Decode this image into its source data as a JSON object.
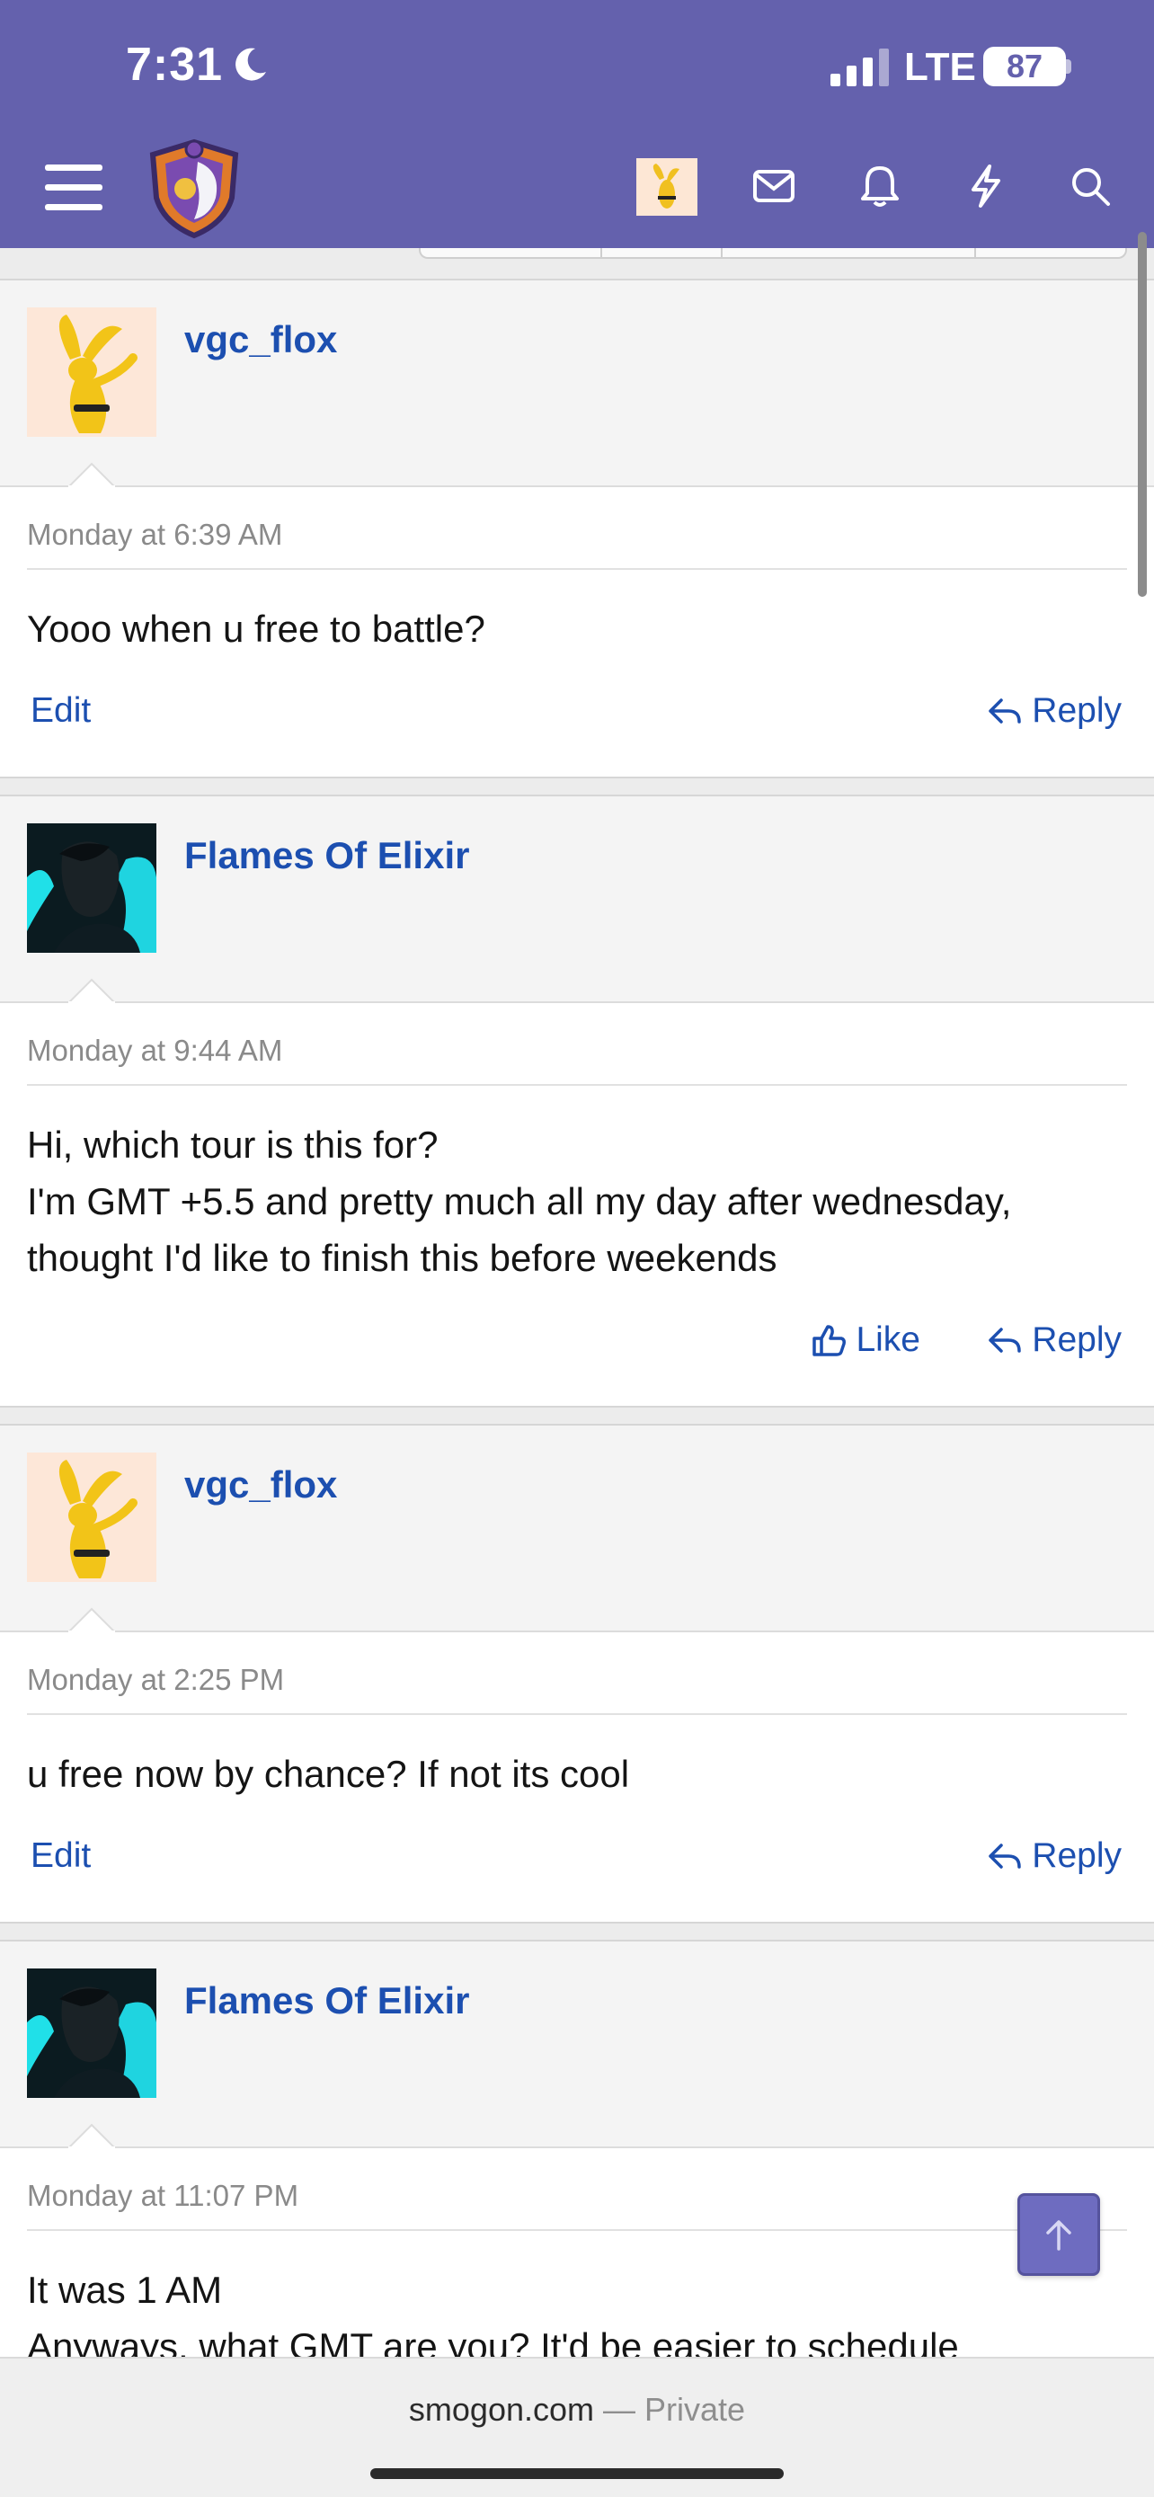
{
  "status_bar": {
    "time": "7:31",
    "network": "LTE",
    "battery": "87"
  },
  "nav": {
    "menu_icon": "hamburger-icon",
    "logo_icon": "smogon-logo",
    "inbox_icon": "envelope-icon",
    "alerts_icon": "bell-icon",
    "whats_new_icon": "bolt-icon",
    "search_icon": "search-icon"
  },
  "messages": [
    {
      "user": "vgc_flox",
      "date": "Monday at 6:39 AM",
      "lines": [
        "Yooo when u free to battle?"
      ],
      "actions": {
        "left": "Edit",
        "right": "Reply"
      }
    },
    {
      "user": "Flames Of Elixir",
      "date": "Monday at 9:44 AM",
      "lines": [
        "Hi, which tour is this for?",
        "I'm GMT +5.5 and pretty much all my day after wednesday,",
        "thought I'd like to finish this before weekends"
      ],
      "actions": {
        "left": "Like",
        "right": "Reply"
      }
    },
    {
      "user": "vgc_flox",
      "date": "Monday at 2:25 PM",
      "lines": [
        "u free now by chance? If not its cool"
      ],
      "actions": {
        "left": "Edit",
        "right": "Reply"
      }
    },
    {
      "user": "Flames Of Elixir",
      "date": "Monday at 11:07 PM",
      "lines": [
        "It was 1 AM",
        "Anyways, what GMT are you? It'd be easier to schedule"
      ]
    }
  ],
  "browser": {
    "domain": "smogon.com",
    "separator": " — ",
    "mode": "Private"
  },
  "colors": {
    "header": "#6461ad",
    "link": "#1c4fb0"
  }
}
